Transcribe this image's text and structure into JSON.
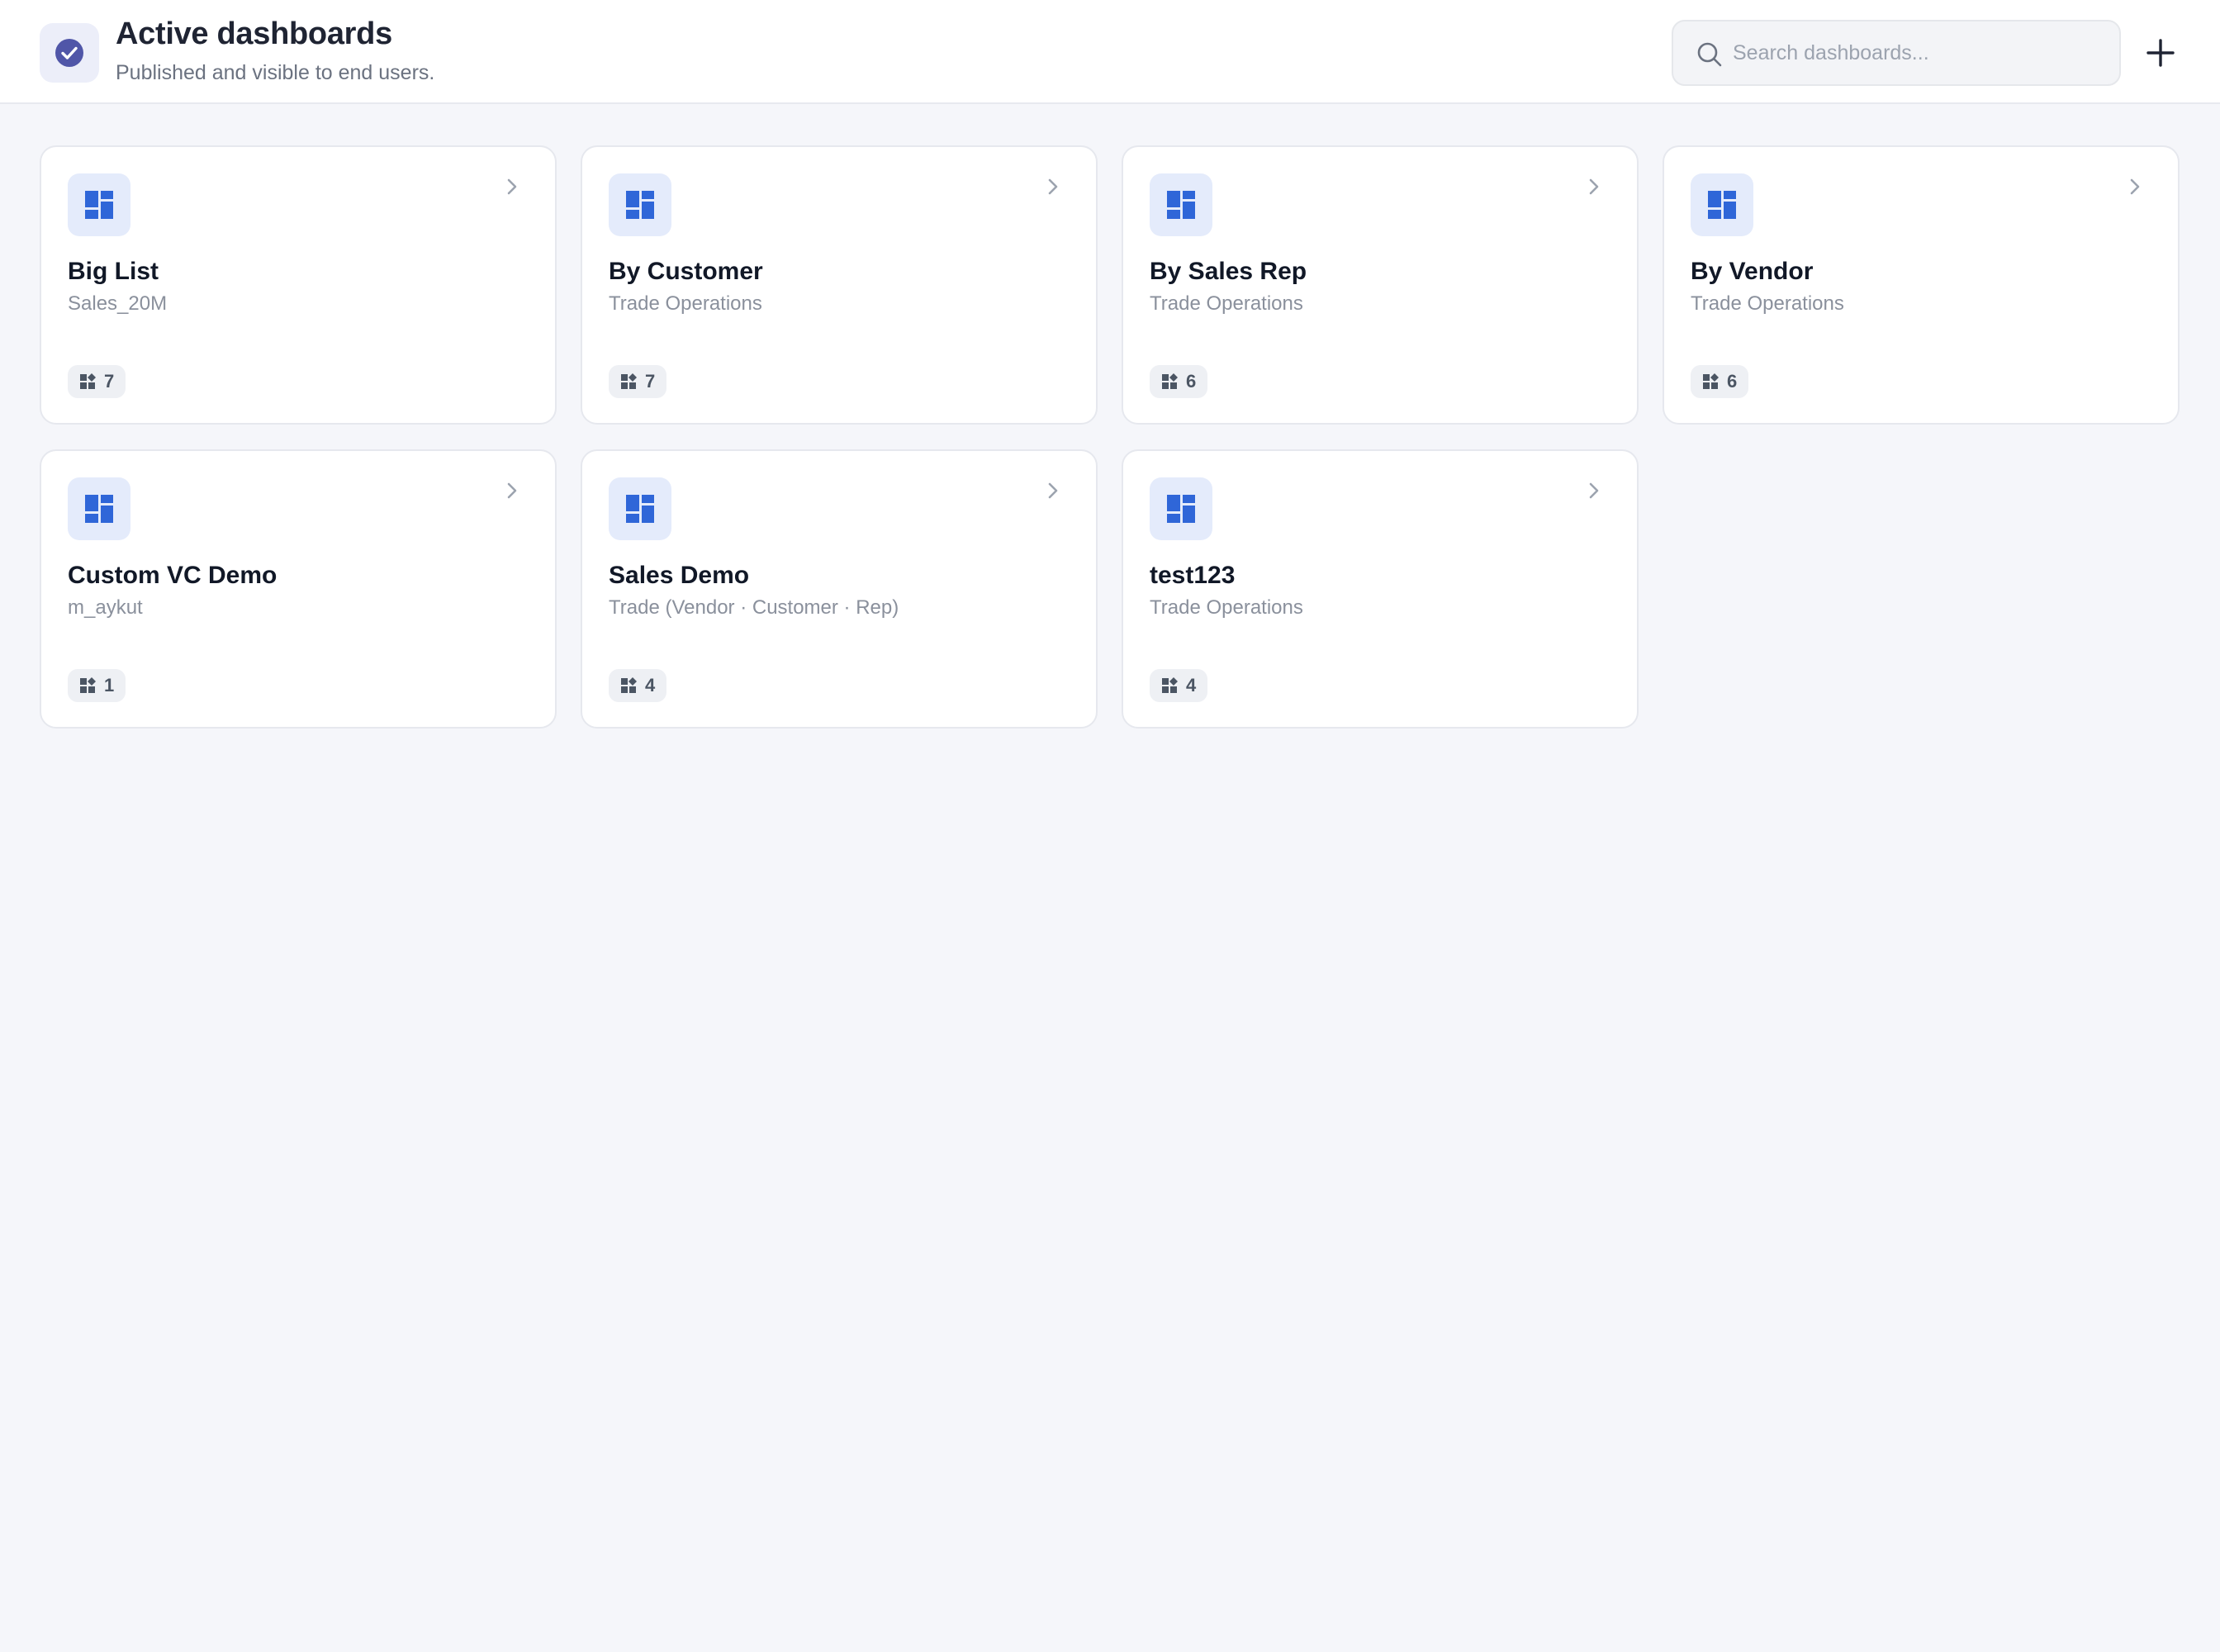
{
  "header": {
    "title": "Active dashboards",
    "subtitle": "Published and visible to end users.",
    "icon": "check-circle-icon",
    "search_placeholder": "Search dashboards...",
    "add_icon": "plus-icon"
  },
  "colors": {
    "accent": "#2f66d8",
    "header_check": "#5056a8",
    "card_icon_bg": "#e4ebfb"
  },
  "dashboards": [
    {
      "title": "Big List",
      "subtitle": "Sales_20M",
      "count": "7"
    },
    {
      "title": "By Customer",
      "subtitle": "Trade Operations",
      "count": "7"
    },
    {
      "title": "By Sales Rep",
      "subtitle": "Trade Operations",
      "count": "6"
    },
    {
      "title": "By Vendor",
      "subtitle": "Trade Operations",
      "count": "6"
    },
    {
      "title": "Custom VC Demo",
      "subtitle": "m_aykut",
      "count": "1"
    },
    {
      "title": "Sales Demo",
      "subtitle": "Trade (Vendor · Customer · Rep)",
      "count": "4"
    },
    {
      "title": "test123",
      "subtitle": "Trade Operations",
      "count": "4"
    }
  ]
}
